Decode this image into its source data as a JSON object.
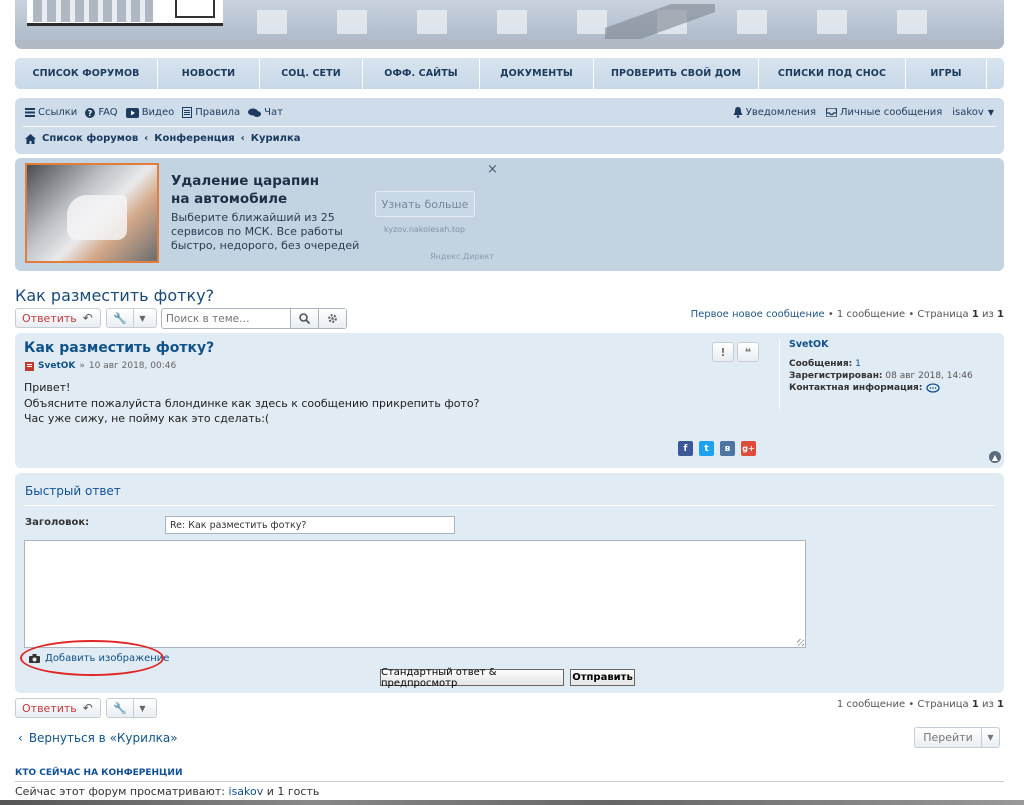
{
  "nav": [
    "Список форумов",
    "Новости",
    "Соц. сети",
    "Офф. сайты",
    "Документы",
    "Проверить свой дом",
    "Списки под снос",
    "Игры"
  ],
  "quicklinks": {
    "links": "Ссылки",
    "faq": "FAQ",
    "video": "Видео",
    "rules": "Правила",
    "chat": "Чат",
    "notifications": "Уведомления",
    "messages": "Личные сообщения",
    "user": "isakov"
  },
  "breadcrumbs": [
    "Список форумов",
    "Конференция",
    "Курилка"
  ],
  "ad": {
    "title": "Удаление царапин на автомобиле",
    "desc": "Выберите ближайший из 25 сервисов по МСК. Все работы быстро, недорого, без очередей",
    "button": "Узнать больше",
    "domain": "kyzov.nakolesah.top",
    "provider": "Яндекс.Директ",
    "close": "×"
  },
  "topic": {
    "title": "Как разместить фотку?",
    "reply": "Ответить",
    "search_placeholder": "Поиск в теме…",
    "pagination": {
      "first_new": "Первое новое сообщение",
      "count": "1 сообщение",
      "page_word": "Страница",
      "page": "1",
      "of": "из",
      "total": "1",
      "bullet": "•"
    }
  },
  "post": {
    "title": "Как разместить фотку?",
    "author": "SvetOK",
    "date": "10 авг 2018, 00:46",
    "lines": [
      "Привет!",
      "Объясните пожалуйста блондинке как здесь к сообщению прикрепить фото?",
      "Час уже сижу, не пойму как это сделать:("
    ],
    "profile": {
      "name": "SvetOK",
      "posts_label": "Сообщения:",
      "posts": "1",
      "reg_label": "Зарегистрирован:",
      "reg": "08 авг 2018, 14:46",
      "contact_label": "Контактная информация:"
    }
  },
  "quickreply": {
    "title": "Быстрый ответ",
    "subject_label": "Заголовок:",
    "subject_value": "Re: Как разместить фотку?",
    "add_image": "Добавить изображение",
    "preview": "Стандартный ответ & предпросмотр",
    "submit": "Отправить"
  },
  "bottom": {
    "reply": "Ответить",
    "pagination": {
      "count": "1 сообщение",
      "page_word": "Страница",
      "page": "1",
      "of": "из",
      "total": "1",
      "bullet": "•"
    },
    "back": "Вернуться в «Курилка»",
    "jump": "Перейти"
  },
  "online": {
    "title": "Кто сейчас на конференции",
    "prefix": "Сейчас этот форум просматривают:",
    "user": "isakov",
    "suffix": "и 1 гость"
  }
}
